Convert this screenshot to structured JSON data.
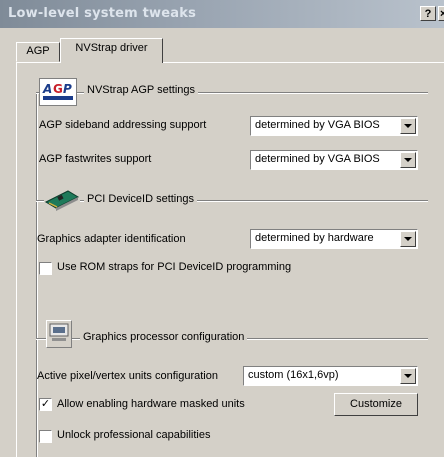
{
  "window": {
    "title": "Low-level system tweaks",
    "help_label": "?",
    "close_label": "×"
  },
  "tabs": [
    {
      "label": "AGP"
    },
    {
      "label": "NVStrap driver"
    }
  ],
  "agp_section": {
    "title": "NVStrap AGP settings",
    "logo_text": "AGP",
    "sideband": {
      "label": "AGP sideband addressing support",
      "value": "determined by VGA BIOS"
    },
    "fastwrites": {
      "label": "AGP fastwrites support",
      "value": "determined by VGA BIOS"
    }
  },
  "pci_section": {
    "title": "PCI DeviceID settings",
    "adapter_id": {
      "label": "Graphics adapter identification",
      "value": "determined by hardware"
    },
    "rom_straps": {
      "label": "Use ROM straps for PCI DeviceID programming",
      "checked": false
    }
  },
  "gpu_section": {
    "title": "Graphics processor configuration",
    "units_config": {
      "label": "Active pixel/vertex units configuration",
      "value": "custom (16x1,6vp)"
    },
    "masked_units": {
      "label": "Allow enabling hardware masked units",
      "checked": true,
      "mark": "✓"
    },
    "customize_label": "Customize",
    "unlock_pro": {
      "label": "Unlock professional capabilities",
      "checked": false
    }
  }
}
